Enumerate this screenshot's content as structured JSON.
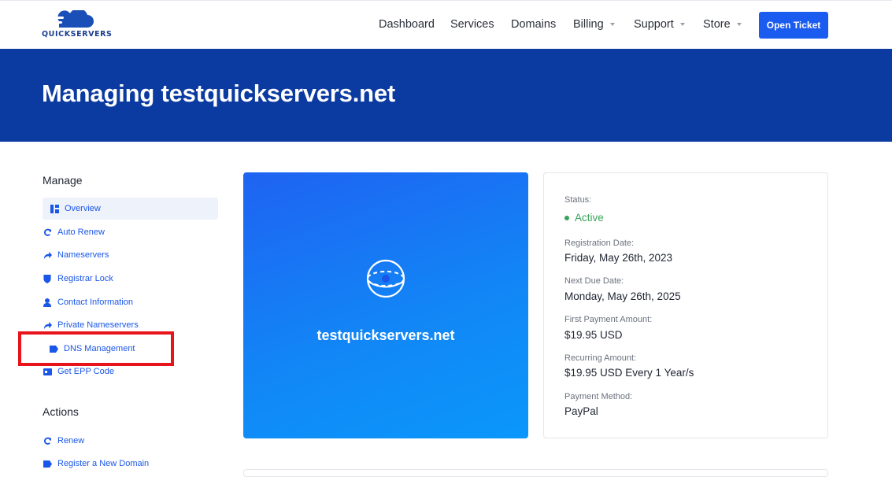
{
  "brand": {
    "name": "QUICKSERVERS"
  },
  "nav": {
    "items": [
      {
        "label": "Dashboard",
        "dropdown": false
      },
      {
        "label": "Services",
        "dropdown": false
      },
      {
        "label": "Domains",
        "dropdown": false
      },
      {
        "label": "Billing",
        "dropdown": true
      },
      {
        "label": "Support",
        "dropdown": true
      },
      {
        "label": "Store",
        "dropdown": true
      }
    ],
    "cta": "Open Ticket"
  },
  "hero": {
    "title": "Managing testquickservers.net"
  },
  "sidebar": {
    "manage_heading": "Manage",
    "manage_items": [
      {
        "label": "Overview",
        "icon": "dashboard-icon",
        "active": true
      },
      {
        "label": "Auto Renew",
        "icon": "refresh-icon"
      },
      {
        "label": "Nameservers",
        "icon": "share-arrow-icon"
      },
      {
        "label": "Registrar Lock",
        "icon": "shield-icon"
      },
      {
        "label": "Contact Information",
        "icon": "user-icon"
      },
      {
        "label": "Private Nameservers",
        "icon": "share-arrow-icon"
      },
      {
        "label": "DNS Management",
        "icon": "tag-icon",
        "highlighted": true
      },
      {
        "label": "Get EPP Code",
        "icon": "id-card-icon"
      }
    ],
    "actions_heading": "Actions",
    "action_items": [
      {
        "label": "Renew",
        "icon": "refresh-icon"
      },
      {
        "label": "Register a New Domain",
        "icon": "tag-icon"
      }
    ]
  },
  "domain_card": {
    "domain": "testquickservers.net",
    "icon": "globe-icon"
  },
  "details": {
    "status_label": "Status:",
    "status_value": "Active",
    "registration_label": "Registration Date:",
    "registration_value": "Friday, May 26th, 2023",
    "due_label": "Next Due Date:",
    "due_value": "Monday, May 26th, 2025",
    "first_payment_label": "First Payment Amount:",
    "first_payment_value": "$19.95 USD",
    "recurring_label": "Recurring Amount:",
    "recurring_value": "$19.95 USD Every 1 Year/s",
    "payment_method_label": "Payment Method:",
    "payment_method_value": "PayPal"
  },
  "colors": {
    "primary": "#1a5bf0",
    "hero": "#0b3aa0",
    "link": "#1a56e8",
    "status_active": "#3aa35a",
    "highlight_box": "#e8141c"
  }
}
